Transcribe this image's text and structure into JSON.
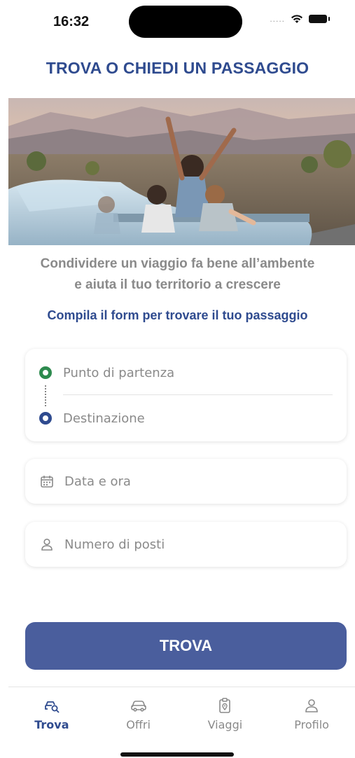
{
  "status_bar": {
    "time": "16:32",
    "signal": ".....",
    "icons": [
      "wifi-icon",
      "battery-icon"
    ]
  },
  "header": {
    "title": "TROVA O CHIEDI UN PASSAGGIO"
  },
  "hero": {
    "image": "friends-in-convertible-car-desert-photo"
  },
  "tagline": {
    "line1": "Condividere un viaggio fa bene all’ambente",
    "line2": "e aiuta il tuo territorio a crescere"
  },
  "form_hint": "Compila il form per trovare il tuo passaggio",
  "form": {
    "departure_placeholder": "Punto di partenza",
    "destination_placeholder": "Destinazione",
    "datetime_placeholder": "Data e ora",
    "seats_placeholder": "Numero di posti"
  },
  "submit_label": "TROVA",
  "tab_bar": {
    "tabs": [
      {
        "label": "Trova",
        "icon": "search-car-icon",
        "active": true
      },
      {
        "label": "Offri",
        "icon": "car-icon",
        "active": false
      },
      {
        "label": "Viaggi",
        "icon": "trip-clipboard-icon",
        "active": false
      },
      {
        "label": "Profilo",
        "icon": "user-icon",
        "active": false
      }
    ]
  },
  "colors": {
    "primary": "#2f4b8f",
    "button": "#4a5e9d",
    "start_dot": "#2d8a4e",
    "muted_text": "#8a8a8a"
  }
}
